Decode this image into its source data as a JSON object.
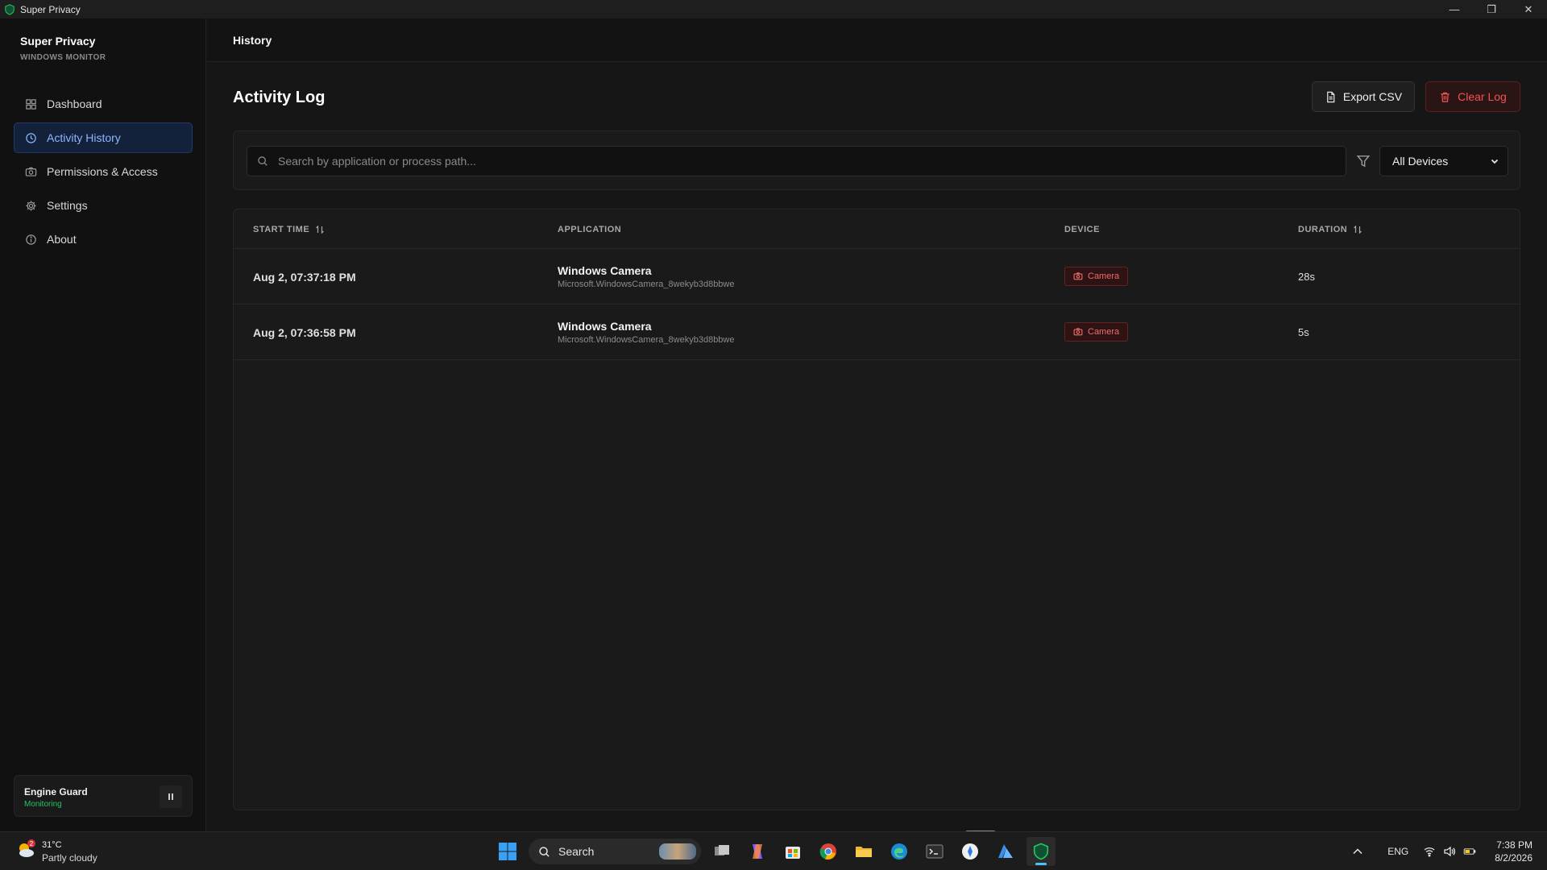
{
  "window": {
    "title": "Super Privacy"
  },
  "sidebar": {
    "brand_title": "Super Privacy",
    "brand_subtitle": "WINDOWS MONITOR",
    "items": [
      {
        "label": "Dashboard",
        "icon": "grid-icon"
      },
      {
        "label": "Activity History",
        "icon": "clock-icon",
        "active": true
      },
      {
        "label": "Permissions & Access",
        "icon": "camera-icon"
      },
      {
        "label": "Settings",
        "icon": "gear-icon"
      },
      {
        "label": "About",
        "icon": "info-icon"
      }
    ],
    "engine": {
      "title": "Engine Guard",
      "status": "Monitoring"
    }
  },
  "header": {
    "title": "History"
  },
  "page": {
    "title": "Activity Log",
    "export_label": "Export CSV",
    "clear_label": "Clear Log"
  },
  "filters": {
    "search_placeholder": "Search by application or process path...",
    "device_selected": "All Devices"
  },
  "table": {
    "columns": [
      "START TIME",
      "APPLICATION",
      "DEVICE",
      "DURATION"
    ],
    "rows": [
      {
        "start_time": "Aug 2, 07:37:18 PM",
        "app_name": "Windows Camera",
        "app_path": "Microsoft.WindowsCamera_8wekyb3d8bbwe",
        "device": "Camera",
        "duration": "28s"
      },
      {
        "start_time": "Aug 2, 07:36:58 PM",
        "app_name": "Windows Camera",
        "app_path": "Microsoft.WindowsCamera_8wekyb3d8bbwe",
        "device": "Camera",
        "duration": "5s"
      }
    ]
  },
  "taskbar": {
    "weather_temp": "31°C",
    "weather_desc": "Partly cloudy",
    "weather_badge": "2",
    "search_label": "Search",
    "lang": "ENG",
    "time": "7:38 PM",
    "date": "8/2/2026"
  },
  "colors": {
    "accent": "#8db6ff",
    "danger": "#f25454",
    "success": "#22c55e"
  }
}
